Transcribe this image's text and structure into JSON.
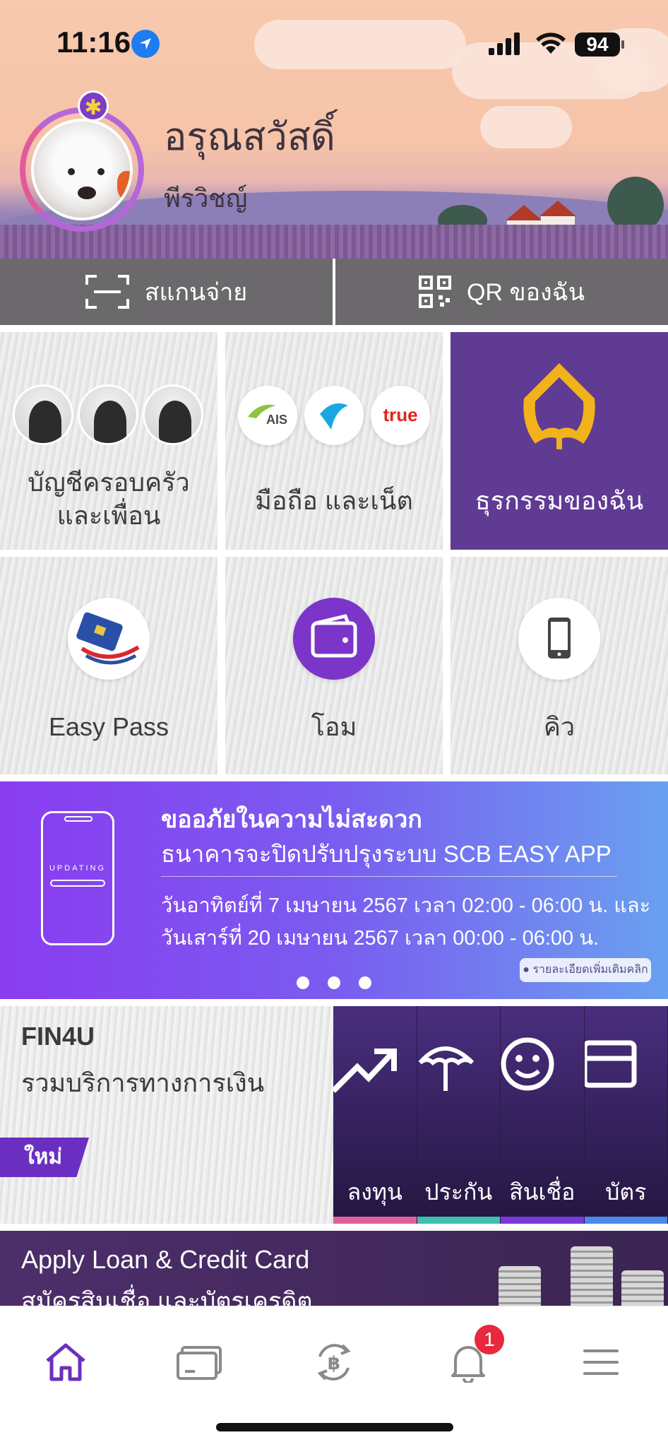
{
  "status_bar": {
    "time": "11:16",
    "battery": "94"
  },
  "profile": {
    "greeting": "อรุณสวัสดิ์",
    "name": "พีรวิชญ์"
  },
  "actions": {
    "scan_label": "สแกนจ่าย",
    "qr_label": "QR ของฉัน"
  },
  "tiles": [
    {
      "line1": "บัญชีครอบครัว",
      "line2": "และเพื่อน"
    },
    {
      "label": "มือถือ และเน็ต",
      "logos": [
        "AIS",
        "dtac",
        "true"
      ]
    },
    {
      "label": "ธุรกรรมของฉัน"
    },
    {
      "label": "Easy Pass"
    },
    {
      "label": "โอม"
    },
    {
      "label": "คิว"
    }
  ],
  "banner": {
    "phone_text": "UPDATING",
    "title": "ขออภัยในความไม่สะดวก",
    "subtitle": "ธนาคารจะปิดปรับปรุงระบบ SCB EASY APP",
    "line1": "วันอาทิตย์ที่ 7 เมษายน 2567 เวลา 02:00 - 06:00 น. และ",
    "line2": "วันเสาร์ที่ 20 เมษายน 2567 เวลา 00:00 - 06:00 น.",
    "more": "● รายละเอียดเพิ่มเติมคลิก"
  },
  "fin4u": {
    "title": "FIN4U",
    "subtitle": "รวมบริการทางการเงิน",
    "tag": "ใหม่",
    "cards": [
      {
        "label": "ลงทุน",
        "icon": "trend-up-icon",
        "color": "#e0609a"
      },
      {
        "label": "ประกัน",
        "icon": "umbrella-icon",
        "color": "#3cc0b0"
      },
      {
        "label": "สินเชื่อ",
        "icon": "smile-icon",
        "color": "#7a3ad8"
      },
      {
        "label": "บัตร",
        "icon": "card-icon",
        "color": "#4a8ae8"
      }
    ]
  },
  "apply": {
    "title": "Apply Loan & Credit Card",
    "subtitle": "สมัครสินเชื่อ และบัตรเครดิต"
  },
  "nav": {
    "notification_count": "1",
    "active_color": "#6a2fc1"
  }
}
